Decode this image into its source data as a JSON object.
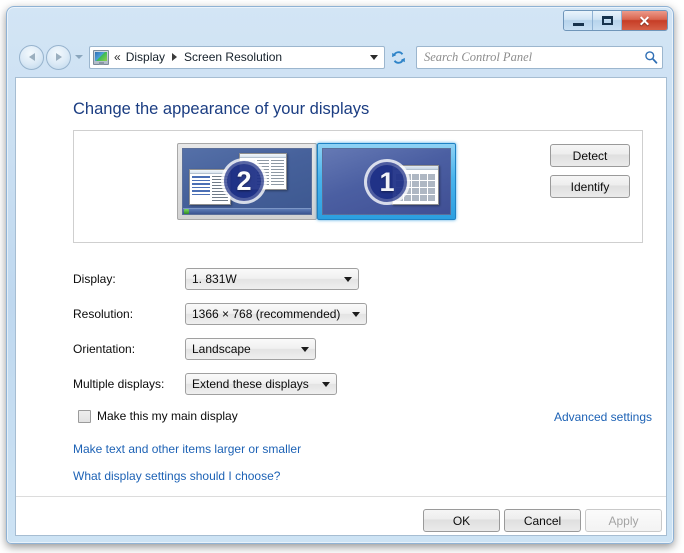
{
  "window": {
    "title_bar": {
      "minimize_label": "Minimize",
      "maximize_label": "Maximize",
      "close_label": "✕"
    }
  },
  "nav": {
    "back_label": "Back",
    "forward_label": "Forward",
    "history_label": "Recent pages",
    "refresh_label": "Refresh",
    "address_icon": "control-panel-display-icon",
    "breadcrumb_prefix": "«",
    "breadcrumbs": [
      {
        "label": "Display"
      },
      {
        "label": "Screen Resolution"
      }
    ],
    "address_dropdown_label": "Previous locations"
  },
  "search": {
    "placeholder": "Search Control Panel",
    "value": "",
    "icon": "search-icon"
  },
  "main": {
    "page_title": "Change the appearance of your displays",
    "preview": {
      "monitors": [
        {
          "number": "2",
          "selected": false,
          "name": "monitor-thumbnail-2"
        },
        {
          "number": "1",
          "selected": true,
          "name": "monitor-thumbnail-1"
        }
      ],
      "detect_label": "Detect",
      "identify_label": "Identify"
    },
    "fields": [
      {
        "label": "Display:",
        "value": "1. 831W"
      },
      {
        "label": "Resolution:",
        "value": "1366 × 768 (recommended)"
      },
      {
        "label": "Orientation:",
        "value": "Landscape"
      },
      {
        "label": "Multiple displays:",
        "value": "Extend these displays"
      }
    ],
    "main_display_checkbox": {
      "label": "Make this my main display",
      "checked": false
    },
    "advanced_settings_link": "Advanced settings",
    "links": [
      {
        "label": "Make text and other items larger or smaller"
      },
      {
        "label": "What display settings should I choose?"
      }
    ]
  },
  "footer": {
    "ok_label": "OK",
    "cancel_label": "Cancel",
    "apply_label": "Apply",
    "apply_disabled": true
  },
  "colors": {
    "accent_link": "#1d62b5",
    "page_title": "#1b3d82",
    "selection_border": "#2b9fe0",
    "badge_blue": "#1d2f86",
    "close_button_red": "#c63d26"
  }
}
